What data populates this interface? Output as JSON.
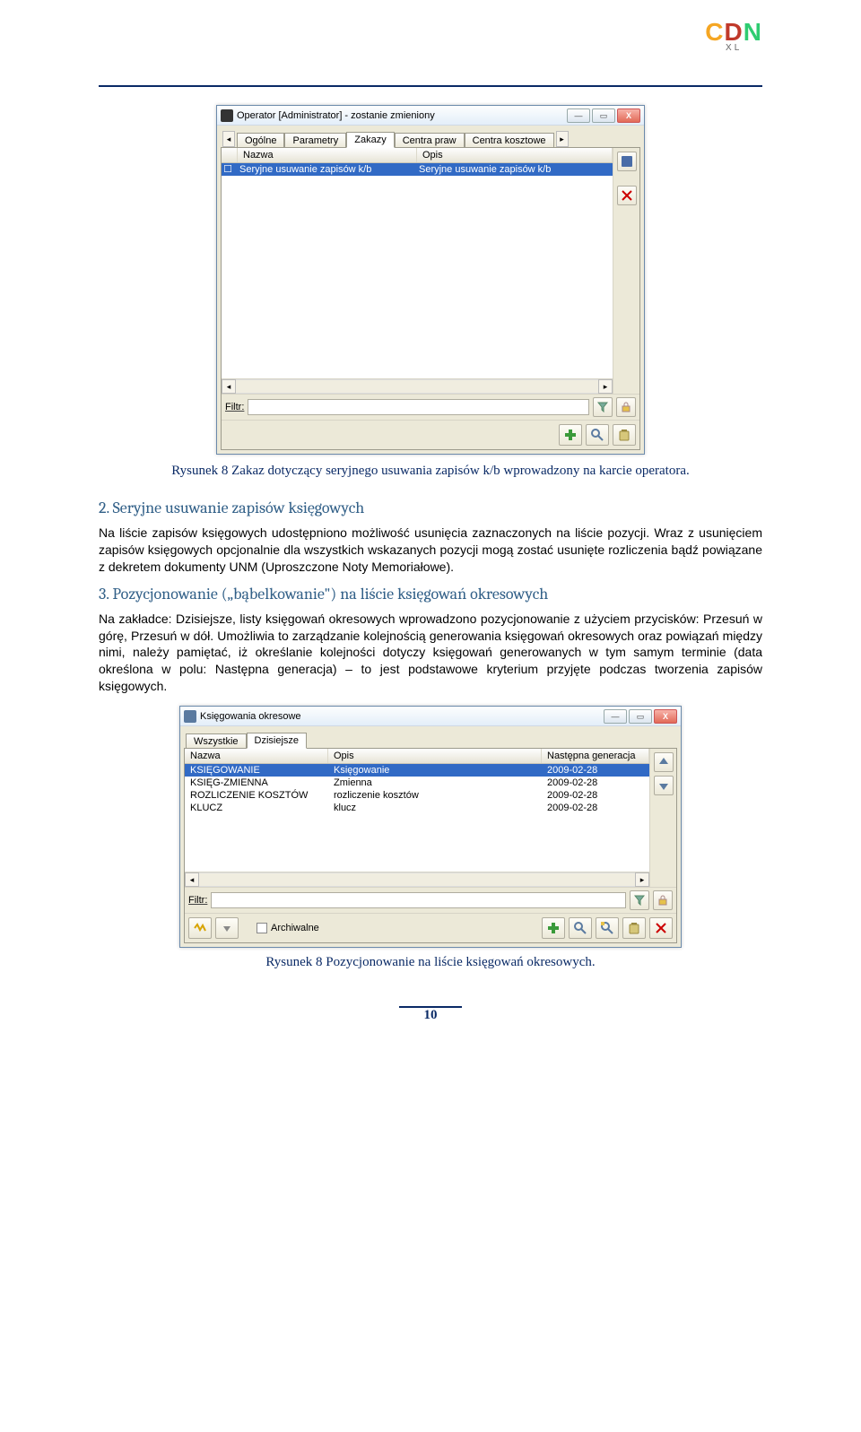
{
  "logo": {
    "c1": "C",
    "c2": "D",
    "c3": "N",
    "sub": "XL"
  },
  "win1": {
    "title": "Operator [Administrator] - zostanie zmieniony",
    "tabs": [
      "Ogólne",
      "Parametry",
      "Zakazy",
      "Centra praw",
      "Centra kosztowe"
    ],
    "active_tab": 2,
    "cols": {
      "nazwa": "Nazwa",
      "opis": "Opis"
    },
    "row": {
      "nazwa": "Seryjne usuwanie zapisów k/b",
      "opis": "Seryjne usuwanie zapisów k/b"
    },
    "filtr_label": "Filtr:",
    "filtr_value": ""
  },
  "caption1": "Rysunek 8 Zakaz dotyczący seryjnego usuwania zapisów k/b wprowadzony na karcie operatora.",
  "heading2": "2.   Seryjne usuwanie zapisów księgowych",
  "para2a": "Na liście zapisów księgowych udostępniono możliwość usunięcia zaznaczonych na liście pozycji. Wraz z usunięciem zapisów księgowych opcjonalnie dla wszystkich wskazanych pozycji mogą zostać usunięte rozliczenia bądź powiązane z dekretem dokumenty UNM (Uproszczone Noty Memoriałowe).",
  "heading3": "3.   Pozycjonowanie („bąbelkowanie\") na liście księgowań okresowych",
  "para3a": "Na zakładce: Dzisiejsze, listy księgowań okresowych wprowadzono pozycjonowanie z użyciem przycisków: Przesuń w górę, Przesuń w dół. Umożliwia to zarządzanie kolejnością generowania księgowań okresowych oraz powiązań między nimi, należy pamiętać, iż określanie kolejności dotyczy księgowań generowanych w tym samym terminie (data określona w polu: Następna generacja) – to jest podstawowe kryterium przyjęte podczas tworzenia zapisów księgowych.",
  "win2": {
    "title": "Księgowania okresowe",
    "tabs": [
      "Wszystkie",
      "Dzisiejsze"
    ],
    "active_tab": 1,
    "cols": {
      "nazwa": "Nazwa",
      "opis": "Opis",
      "nastgen": "Następna generacja"
    },
    "rows": [
      {
        "nazwa": "KSIĘGOWANIE",
        "opis": "Księgowanie",
        "nastgen": "2009-02-28"
      },
      {
        "nazwa": "KSIĘG-ZMIENNA",
        "opis": "Zmienna",
        "nastgen": "2009-02-28"
      },
      {
        "nazwa": "ROZLICZENIE KOSZTÓW",
        "opis": "rozliczenie kosztów",
        "nastgen": "2009-02-28"
      },
      {
        "nazwa": "KLUCZ",
        "opis": "klucz",
        "nastgen": "2009-02-28"
      }
    ],
    "filtr_label": "Filtr:",
    "filtr_value": "",
    "archiwalne": "Archiwalne"
  },
  "caption2": "Rysunek 8 Pozycjonowanie na liście księgowań okresowych.",
  "page_number": "10"
}
